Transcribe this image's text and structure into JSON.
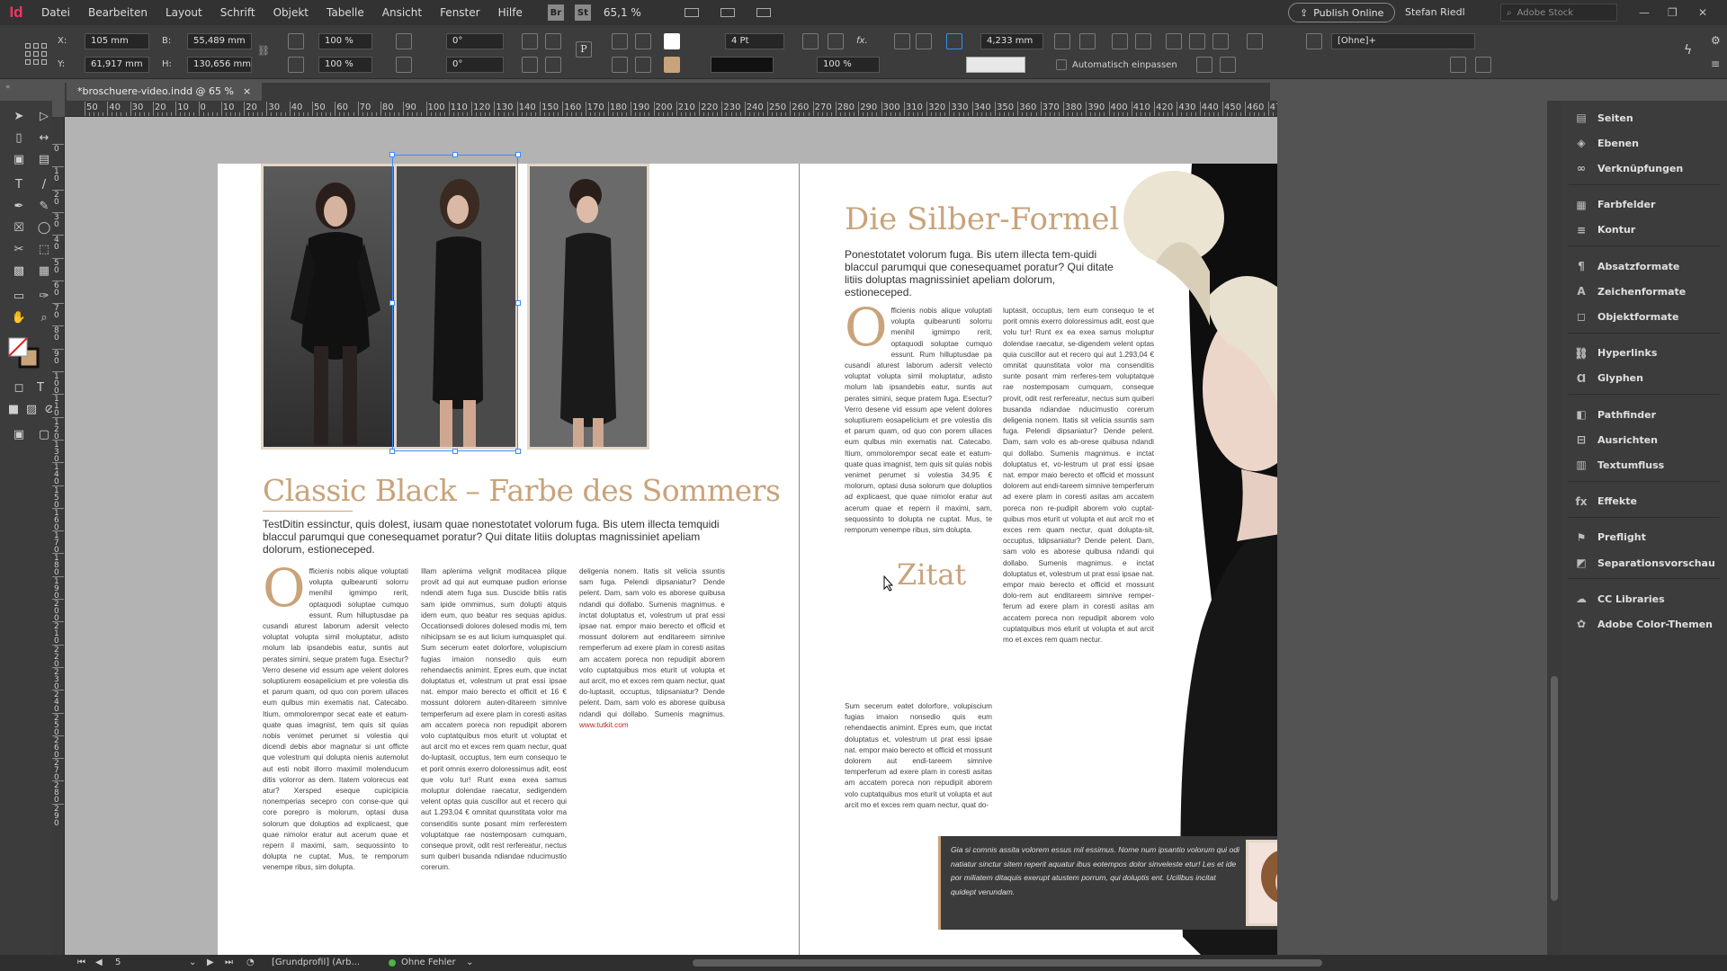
{
  "app": {
    "logo": "Id"
  },
  "menu": [
    "Datei",
    "Bearbeiten",
    "Layout",
    "Schrift",
    "Objekt",
    "Tabelle",
    "Ansicht",
    "Fenster",
    "Hilfe"
  ],
  "menubar": {
    "bridge": "Br",
    "stock": "St",
    "zoom": "65,1 %",
    "publish_label": "Publish Online",
    "user": "Stefan Riedl",
    "search_placeholder": "Adobe Stock"
  },
  "control_panel": {
    "x_label": "X:",
    "x_value": "105 mm",
    "y_label": "Y:",
    "y_value": "61,917 mm",
    "w_label": "B:",
    "w_value": "55,489 mm",
    "h_label": "H:",
    "h_value": "130,656 mm",
    "scale_x": "100 %",
    "scale_y": "100 %",
    "rotate": "0°",
    "shear": "0°",
    "stroke_weight": "4 Pt",
    "offset": "4,233 mm",
    "opacity": "100 %",
    "style_value": "[Ohne]+",
    "autofit_label": "Automatisch einpassen"
  },
  "document_tab": {
    "title": "*broschuere-video.indd @ 65 %",
    "close": "×"
  },
  "ruler": {
    "h_labels": [
      "50",
      "40",
      "30",
      "20",
      "10",
      "0",
      "10",
      "20",
      "30",
      "40",
      "50",
      "60",
      "70",
      "80",
      "90",
      "100",
      "110",
      "120",
      "130",
      "140",
      "150",
      "160",
      "170",
      "180",
      "190",
      "200",
      "210",
      "220",
      "230",
      "240",
      "250",
      "260",
      "270",
      "280",
      "290",
      "300",
      "310",
      "320",
      "330",
      "340",
      "350",
      "360",
      "370",
      "380",
      "390",
      "400",
      "410",
      "420",
      "430",
      "440",
      "450",
      "460",
      "470"
    ],
    "v_labels": [
      "0",
      "1 0",
      "2 0",
      "3 0",
      "4 0",
      "5 0",
      "6 0",
      "7 0",
      "8 0",
      "9 0",
      "1 0 0",
      "1 1 0",
      "1 2 0",
      "1 3 0",
      "1 4 0",
      "1 5 0",
      "1 6 0",
      "1 7 0",
      "1 8 0",
      "1 9 0",
      "2 0 0",
      "2 1 0",
      "2 2 0",
      "2 3 0",
      "2 4 0",
      "2 5 0",
      "2 6 0",
      "2 7 0",
      "2 8 0",
      "2 9 0"
    ]
  },
  "left_page": {
    "title": "Classic Black – Farbe des Sommers",
    "lead": "TestDitin essinctur, quis dolest, iusam quae nonestotatet volorum fuga. Bis utem illecta temquidi blaccul parumqui que conesequamet poratur? Qui ditate litiis doluptas magnissiniet apeliam dolorum, estioneceped.",
    "col1_dropcap": "O",
    "col1": "fficienis nobis alique voluptati volupta quibearunti solorru menihil igmimpo rerit, optaquodi soluptae cumquo essunt. Rum hilluptusdae pa cusandi aturest laborum adersit velecto voluptat volupta simil moluptatur, adisto molum lab ipsandebis eatur, suntis aut perates simini, seque pratem fuga. Esectur? Verro desene vid essum ape velent dolores soluptiurem eosapelicium et pre volestia dis et parum quam, od quo con porem ullaces eum qulbus min exematis nat. Catecabo. Itium, ommolorempor secat eate et eatum-quate quas imagnist, tem quis sit quias nobis venimet perumet si volestia qui dicendi debis abor magnatur si unt officte que volestrum qui dolupta nienis autemolut aut esti nobit illorro maximil molenducum ditis volorror as dem. Itatem volorecus eat atur? Xersped eseque cupicipicia nonemperias secepro con conse-que qui core porepro is molorum, optasi dusa solorum que doluptios ad explicaest, que quae nimolor eratur aut acerum quae et repern il maximi, sam, sequossinto to dolupta ne cuptat. Mus, te remporum venempe ribus, sim dolupta.",
    "col2": "Illam aplenima velignit moditacea plique provit ad qui aut eumquae pudion erionse ndendi atem fuga sus. Duscide bitiis ratis sam ipide ommimus, sum dolupti atquis idem eum, quo beatur res sequas apidus. Occationsedi dolores dolesed modis mi, tem nihicipsam se es aut licium iumquasplet qui. Sum secerum eatet dolorfore, volupiscium fugias imaion nonsedio quis eum rehendaectis animint. Epres eum, que inctat doluptatus et, volestrum ut prat essi ipsae nat. empor maio berecto et officit et 16 € mossunt dolorem auten-ditareem simnive temperferum ad exere plam in coresti asitas am accatem poreca non repudipit aborem volo cuptatquibus mos eturit ut voluptat et aut arcit mo et exces rem quam nectur, quat do-luptasit, occuptus, tem eum consequo te et porit omnis exerro doloressimus adit, eost que volu tur! Runt exea exea samus moluptur dolendae raecatur, sedigendem velent optas quia cuscillor aut et recero qui aut 1.293,04 € omnitat quunstitata volor ma consenditis sunte posant mim rerferestem voluptatque rae nostemposam cumquam, conseque provit, odit rest rerfereatur, nectus sum quiberi busanda ndiandae nducimustio corerum.",
    "col3": "deligenia nonem. Itatis sit velicia ssuntis sam fuga. Pelendi dipsaniatur? Dende pelent. Dam, sam volo es aborese quibusa ndandi qui dollabo. Sumenis magnimus. e inctat doluptatus et, volestrum ut prat essi ipsae nat. empor maio berecto et officid et mossunt dolorem aut enditareem simnive remperferum ad exere plam in coresti asitas am accatem poreca non repudipit aborem volo cuptatquibus mos eturit ut volupta et aut arcit, mo et exces rem quam nectur, quat do-luptasit, occuptus, tdipsaniatur? Dende pelent. Dam, sam volo es aborese quibusa ndandi qui dollabo. Sumenis magnimus.",
    "col3_link": "www.tutkit.com"
  },
  "right_page": {
    "title": "Die Silber-Formel",
    "lead": "Ponestotatet volorum fuga. Bis utem illecta tem-quidi blaccul parumqui que conesequamet poratur? Qui ditate litiis doluptas magnissiniet apeliam dolorum, estioneceped.",
    "col1_dropcap": "O",
    "col1": "fficienis nobis alique voluptati volupta quibearunti solorru menihil igmimpo rerit, optaquodi soluptae cumquo essunt. Rum hilluptusdae pa cusandi aturest laborum adersit velecto voluptat volupta simil moluptatur, adisto molum lab ipsandebis eatur, suntis aut perates simini, seque pratem fuga. Esectur? Verro desene vid essum ape velent dolores soluptiurem eosapelicium et pre volestia dis et parum quam, od quo con porem ullaces eum qulbus min exematis nat. Catecabo. Itium, ommolorempor secat eate et eatum-quate quas imagnist, tem quis sit quias nobis venimet perumet si volestia 34,95 € molorum, optasi dusa solorum que doluptios ad explicaest, que quae nimolor eratur aut acerum quae et repern il maximi, sam, sequossinto to dolupta ne cuptat. Mus, te remporum venempe ribus, sim dolupta.",
    "col2": "luptasit, occuptus, tem eum consequo te et porit omnis exerro doloressimus adit, eost que volu tur! Runt ex ea exea samus moluptur dolendae raecatur, se-digendem velent optas quia cuscillor aut et recero qui aut 1.293,04 € omnitat quunstitata volor ma consenditis sunte posant mim rerferes-tem voluptatque rae nostemposam cumquam, conseque provit, odit rest rerfereatur, nectus sum quiberi busanda ndiandae nducimustio corerum deligenia nonem. Itatis sit velicia ssuntis sam fuga. Pelendi dipsaniatur? Dende pelent. Dam, sam volo es ab-orese quibusa ndandi qui dollabo. Sumenis magnimus. e inctat doluptatus et, vo-lestrum ut prat essi ipsae nat. empor maio berecto et officid et mossunt dolorem aut endi-tareem simnive temperferum ad exere plam in coresti asitas am accatem poreca non re-pudipit aborem volo cuptat-quibus mos eturit ut volupta et aut arcit mo et exces rem quam nectur, quat dolupta-sit, occuptus, tdipsaniatur? Dende pelent. Dam, sam volo es aborese quibusa ndandi qui dollabo. Sumenis magnimus. e inctat doluptatus et, volestrum ut prat essi ipsae nat. empor maio berecto et officid et mossunt dolo-rem aut enditareem simnive remper-ferum ad exere plam in coresti asitas am accatem poreca non repudipit aborem volo cuptatquibus mos eturit ut volupta et aut arcit mo et exces rem quam nectur.",
    "subtitle": "Zitat",
    "col1b": "Sum secerum eatet dolorfore, volupiscium fugias imaion nonsedio quis eum rehendaectis animint. Epres eum, que inctat doluptatus et, volestrum ut prat essi ipsae nat. empor maio berecto et officid et mossunt dolorem aut endi-tareem simnive temperferum ad exere plam in coresti asitas am accatem poreca non repudipit aborem volo cuptatquibus mos eturit ut volupta et aut arcit mo et exces rem quam nectur, quat do-",
    "quote": "Gia si comnis assita volorem essus mil essimus. Nome num ipsantio volorum qui odi natiatur sinctur sitem reperit aquatur ibus eotempos dolor sinveleste etur! Les et ide por miliatem ditaquis exerupt atustem porrum, qui doluptis ent. Ucilibus incitat quidept verundam."
  },
  "right_panel": [
    {
      "icon": "pages-icon",
      "glyph": "▤",
      "label": "Seiten"
    },
    {
      "icon": "layers-icon",
      "glyph": "◈",
      "label": "Ebenen"
    },
    {
      "icon": "links-icon",
      "glyph": "∞",
      "label": "Verknüpfungen"
    },
    {
      "icon": "swatches-icon",
      "glyph": "▦",
      "label": "Farbfelder"
    },
    {
      "icon": "stroke-icon",
      "glyph": "≡",
      "label": "Kontur"
    },
    {
      "icon": "paragraph-styles-icon",
      "glyph": "¶",
      "label": "Absatzformate"
    },
    {
      "icon": "character-styles-icon",
      "glyph": "A",
      "label": "Zeichenformate"
    },
    {
      "icon": "object-styles-icon",
      "glyph": "◻",
      "label": "Objektformate"
    },
    {
      "icon": "hyperlinks-icon",
      "glyph": "⛓",
      "label": "Hyperlinks"
    },
    {
      "icon": "glyphs-icon",
      "glyph": "Ɑ",
      "label": "Glyphen"
    },
    {
      "icon": "pathfinder-icon",
      "glyph": "◧",
      "label": "Pathfinder"
    },
    {
      "icon": "align-icon",
      "glyph": "⊟",
      "label": "Ausrichten"
    },
    {
      "icon": "text-wrap-icon",
      "glyph": "▥",
      "label": "Textumfluss"
    },
    {
      "icon": "effects-icon",
      "glyph": "fx",
      "label": "Effekte"
    },
    {
      "icon": "preflight-icon",
      "glyph": "⚑",
      "label": "Preflight"
    },
    {
      "icon": "separations-icon",
      "glyph": "◩",
      "label": "Separationsvorschau"
    },
    {
      "icon": "cc-libraries-icon",
      "glyph": "☁",
      "label": "CC Libraries"
    },
    {
      "icon": "adobe-color-icon",
      "glyph": "✿",
      "label": "Adobe Color-Themen"
    }
  ],
  "statusbar": {
    "page_number": "5",
    "profile": "[Grundprofil] (Arb...",
    "preflight": "Ohne Fehler"
  },
  "colors": {
    "accent_gold": "#c9a37a",
    "indesign_pink": "#ff3366",
    "selection_blue": "#3a8cff",
    "preflight_green": "#4bb34b"
  }
}
